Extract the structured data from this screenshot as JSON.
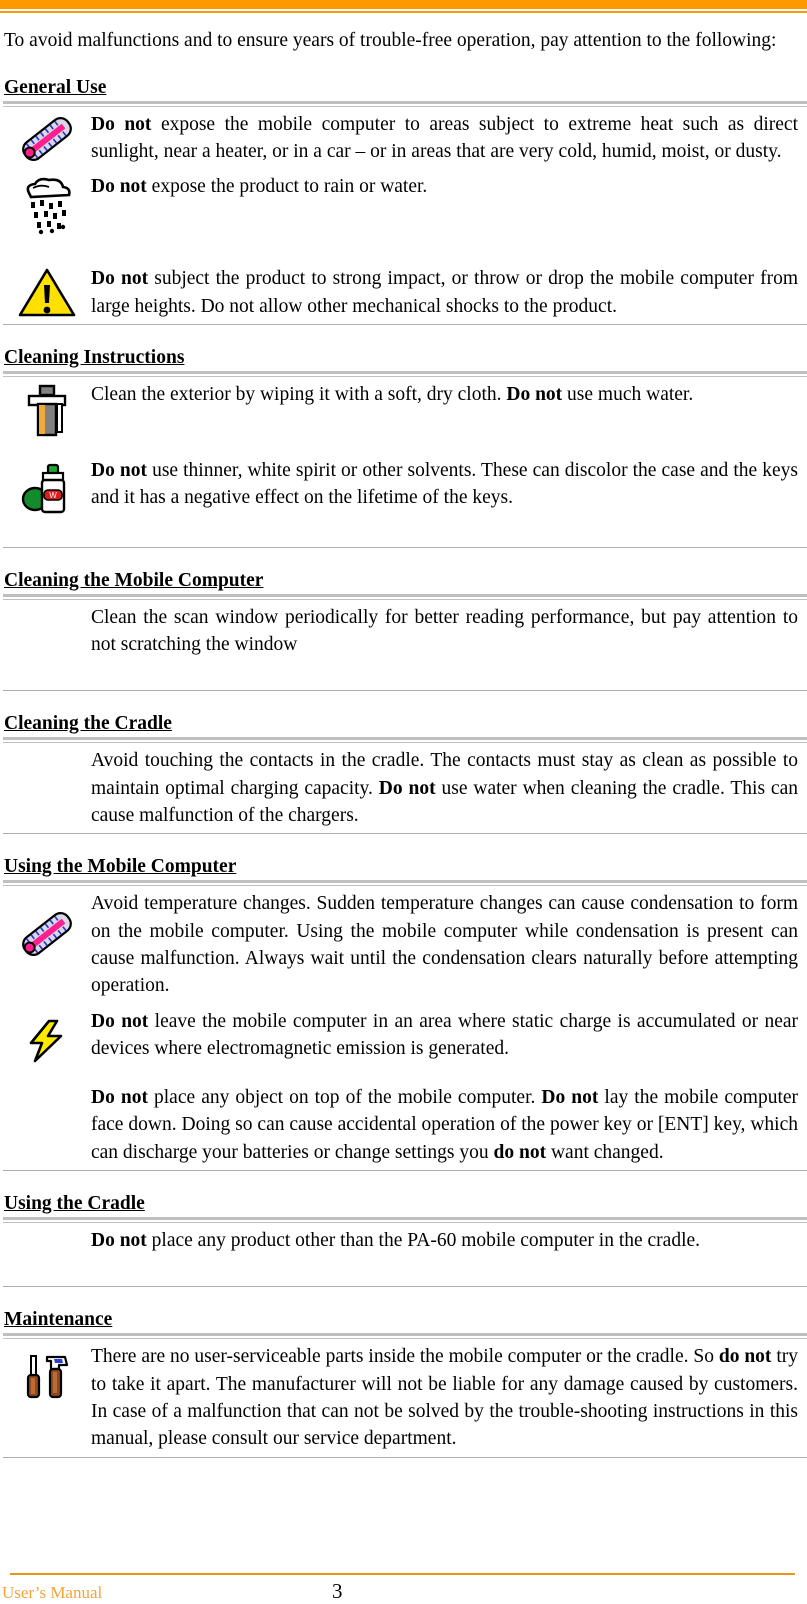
{
  "page": {
    "accent_color": "#FF9900",
    "rule_color": "#BFBFBF",
    "intro": "To avoid malfunctions and to ensure years of trouble-free operation, pay attention to the following:"
  },
  "sections": [
    {
      "id": "general-use",
      "heading": "General Use",
      "items": [
        {
          "icon": "thermometer-icon",
          "lead": "Do not",
          "text": " expose the mobile computer to areas subject to extreme heat such as direct sunlight, near a heater, or in a car – or in areas that are very cold, humid, moist, or dusty."
        },
        {
          "icon": "rain-cloud-icon",
          "lead": "Do not",
          "text": " expose the product to rain or water."
        },
        {
          "icon": "warning-triangle-icon",
          "lead": "Do not",
          "text": " subject the product to strong impact, or throw or drop the mobile computer from large heights. Do not allow other mechanical shocks to the product."
        }
      ]
    },
    {
      "id": "cleaning-instructions",
      "heading": "Cleaning Instructions",
      "items": [
        {
          "icon": "cleaning-cloth-icon",
          "lead": "",
          "text": "Clean the exterior by wiping it with a soft, dry cloth. ",
          "lead_mid": "Do not",
          "text_after": " use much water."
        },
        {
          "icon": "spray-can-icon",
          "lead": "Do not",
          "text": " use thinner, white spirit or other solvents. These can discolor the case and the keys and it has a negative effect on the lifetime of the keys."
        }
      ]
    },
    {
      "id": "cleaning-the-mobile-computer",
      "heading": "Cleaning the Mobile Computer",
      "items": [
        {
          "icon": "",
          "lead": "",
          "text": "Clean the scan window periodically for better reading performance, but pay attention to not scratching the window"
        }
      ]
    },
    {
      "id": "cleaning-the-cradle",
      "heading": "Cleaning the Cradle",
      "items": [
        {
          "icon": "",
          "lead": "",
          "text": "Avoid touching the contacts in the cradle. The contacts must stay as clean as possible to maintain optimal charging capacity. ",
          "lead_mid": "Do not",
          "text_after": " use water when cleaning the cradle. This can cause malfunction of the chargers."
        }
      ]
    },
    {
      "id": "using-the-mobile-computer",
      "heading": "Using the Mobile Computer",
      "items": [
        {
          "icon": "thermometer-icon",
          "lead": "",
          "text": "Avoid temperature changes. Sudden temperature changes can cause condensation to form on the mobile computer. Using the mobile computer while condensation is present can cause malfunction. Always wait until the condensation clears naturally before attempting operation."
        },
        {
          "icon": "lightning-bolt-icon",
          "lead": "Do not",
          "text": " leave the mobile computer in an area where static charge is accumulated or near devices where electromagnetic emission is generated."
        },
        {
          "icon": "",
          "lead": "Do not",
          "text": " place any object on top of the mobile computer. ",
          "lead_mid": "Do not",
          "text_after": " lay the mobile computer face down. Doing so can cause accidental operation of the power key or [ENT] key, which can discharge your batteries or change settings you ",
          "lead_end": "do not",
          "text_end": " want changed."
        }
      ]
    },
    {
      "id": "using-the-cradle",
      "heading": "Using the Cradle",
      "items": [
        {
          "icon": "",
          "lead": "Do not",
          "text": " place any product other than the PA-60 mobile computer in the cradle."
        }
      ]
    },
    {
      "id": "maintenance",
      "heading": "Maintenance",
      "items": [
        {
          "icon": "tools-icon",
          "lead": "",
          "text": "There are no user-serviceable parts inside the mobile computer or the cradle. So ",
          "lead_mid": "do not",
          "text_after": " try to take it apart. The manufacturer will not be liable for any damage caused by customers. In case of a malfunction that can not be solved by the trouble-shooting instructions in this manual, please consult our service department."
        }
      ]
    }
  ],
  "footer": {
    "left": "User’s Manual",
    "page_number": "3"
  }
}
